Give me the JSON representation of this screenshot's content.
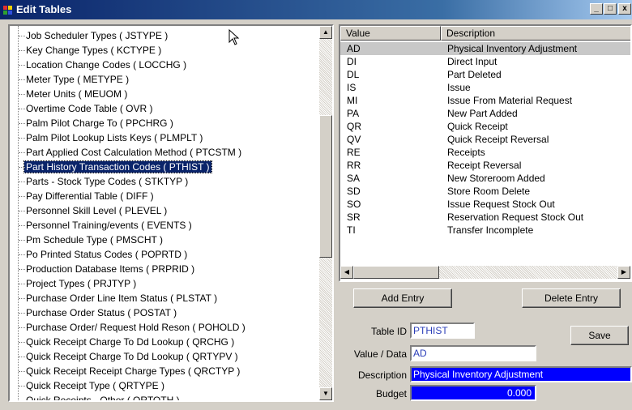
{
  "window": {
    "title": "Edit Tables",
    "btn_min": "_",
    "btn_max": "□",
    "btn_close": "x"
  },
  "tree": {
    "items": [
      "Job Scheduler Types  ( JSTYPE )",
      "Key Change Types  ( KCTYPE )",
      "Location Change Codes  ( LOCCHG )",
      "Meter Type  ( METYPE )",
      "Meter Units  ( MEUOM )",
      "Overtime Code Table  ( OVR )",
      "Palm Pilot Charge To  ( PPCHRG )",
      "Palm Pilot Lookup Lists Keys  ( PLMPLT )",
      "Part Applied Cost Calculation Method  ( PTCSTM )",
      "Part History Transaction Codes  ( PTHIST )",
      "Parts - Stock Type Codes  ( STKTYP )",
      "Pay Differential Table  ( DIFF )",
      "Personnel Skill Level  ( PLEVEL )",
      "Personnel Training/events  ( EVENTS )",
      "Pm Schedule Type  ( PMSCHT )",
      "Po Printed Status Codes  ( POPRTD )",
      "Production Database Items  ( PRPRID )",
      "Project Types  ( PRJTYP )",
      "Purchase Order Line Item Status  ( PLSTAT )",
      "Purchase Order Status  ( POSTAT )",
      "Purchase Order/ Request Hold Reson  ( POHOLD )",
      "Quick Receipt Charge To Dd Lookup  ( QRCHG )",
      "Quick Receipt Charge To Dd Lookup  ( QRTYPV )",
      "Quick Receipt Receipt Charge Types  ( QRCTYP )",
      "Quick Receipt Type  ( QRTYPE )",
      "Quick Receipts - Other  ( QRTOTH )"
    ],
    "selected_index": 9
  },
  "list": {
    "col_value": "Value",
    "col_desc": "Description",
    "rows": [
      {
        "v": "AD",
        "d": "Physical Inventory Adjustment"
      },
      {
        "v": "DI",
        "d": "Direct Input"
      },
      {
        "v": "DL",
        "d": "Part Deleted"
      },
      {
        "v": "IS",
        "d": "Issue"
      },
      {
        "v": "MI",
        "d": "Issue From Material Request"
      },
      {
        "v": "PA",
        "d": "New Part Added"
      },
      {
        "v": "QR",
        "d": "Quick Receipt"
      },
      {
        "v": "QV",
        "d": "Quick Receipt Reversal"
      },
      {
        "v": "RE",
        "d": "Receipts"
      },
      {
        "v": "RR",
        "d": "Receipt Reversal"
      },
      {
        "v": "SA",
        "d": "New Storeroom Added"
      },
      {
        "v": "SD",
        "d": "Store Room Delete"
      },
      {
        "v": "SO",
        "d": "Issue Request Stock Out"
      },
      {
        "v": "SR",
        "d": "Reservation Request Stock Out"
      },
      {
        "v": "TI",
        "d": "Transfer Incomplete"
      }
    ],
    "selected_index": 0
  },
  "buttons": {
    "add": "Add Entry",
    "delete": "Delete Entry",
    "save": "Save"
  },
  "form": {
    "table_id_label": "Table ID",
    "table_id": "PTHIST",
    "value_label": "Value / Data",
    "value": "AD",
    "desc_label": "Description",
    "desc": "Physical Inventory Adjustment",
    "budget_label": "Budget",
    "budget": "0.000"
  }
}
